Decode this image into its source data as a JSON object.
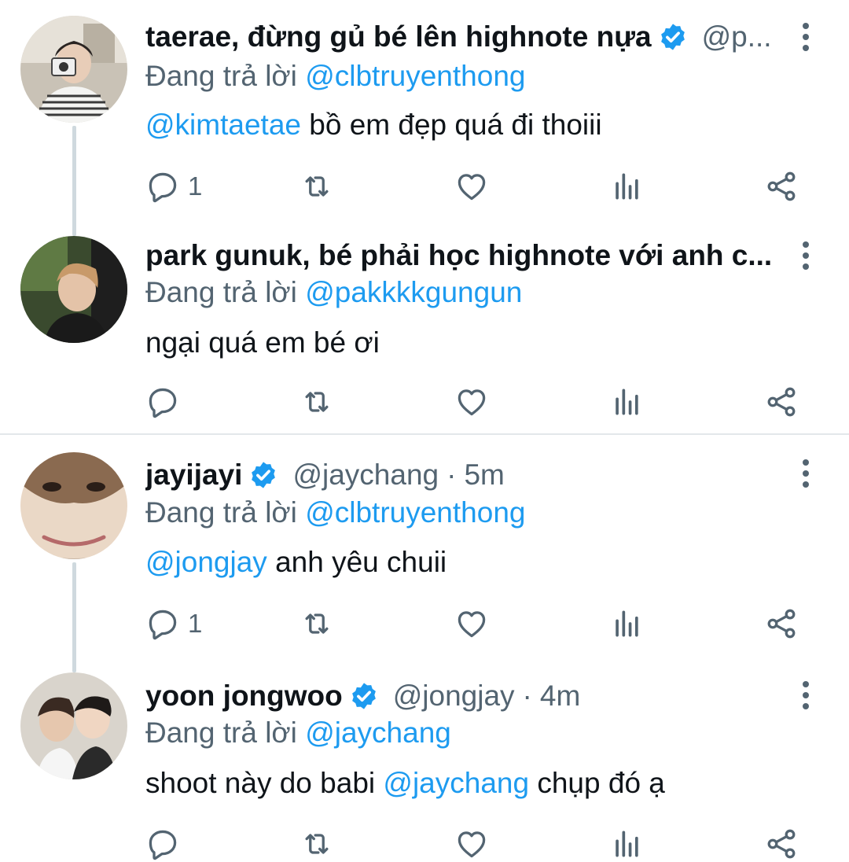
{
  "tweets": [
    {
      "name": "taerae, đừng gủ bé lên highnote nựa",
      "handle": "@p...",
      "reply_label": "Đang trả lời",
      "reply_to": "@clbtruyenthong",
      "mention": "@kimtaetae",
      "text": " bồ em đẹp quá đi thoiii",
      "reply_count": "1"
    },
    {
      "name": "park gunuk, bé phải học highnote với anh c...",
      "reply_label": "Đang trả lời",
      "reply_to": "@pakkkkgungun",
      "text": "ngại quá em bé ơi",
      "reply_count": ""
    },
    {
      "name": "jayijayi",
      "handle": "@jaychang",
      "dot": "·",
      "time": "5m",
      "reply_label": "Đang trả lời",
      "reply_to": "@clbtruyenthong",
      "mention": "@jongjay",
      "text": " anh yêu chuii",
      "reply_count": "1"
    },
    {
      "name": "yoon jongwoo",
      "handle": "@jongjay",
      "dot": "·",
      "time": "4m",
      "reply_label": "Đang trả lời",
      "reply_to": "@jaychang",
      "text_before": "shoot này do babi ",
      "mention": "@jaychang",
      "text_after": " chụp đó ạ",
      "reply_count": ""
    }
  ],
  "icons": {
    "reply": "reply-icon",
    "retweet": "retweet-icon",
    "like": "heart-icon",
    "views": "views-icon",
    "share": "share-icon",
    "verified": "verified-badge-icon",
    "more": "more-options-icon"
  },
  "colors": {
    "link": "#1d9bf0",
    "muted": "#536471",
    "text": "#0f1419",
    "verified": "#1d9bf0"
  }
}
